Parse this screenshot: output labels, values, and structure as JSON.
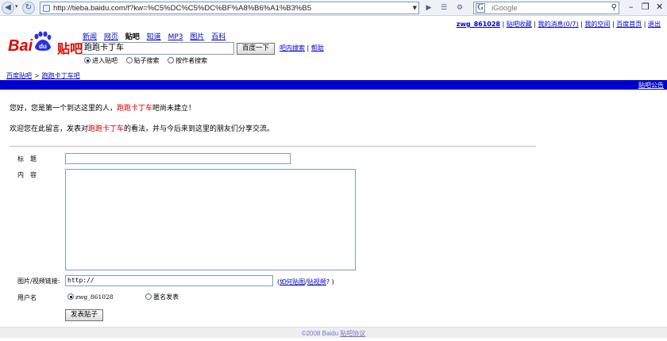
{
  "browser": {
    "address": "http://tieba.baidu.com/f?kw=%C5%DC%C5%DC%BF%A8%B6%A1%B3%B5",
    "search_placeholder": "iGoogle",
    "back_icon": "back-arrow-icon",
    "forward_icon": "forward-arrow-icon"
  },
  "userbar": {
    "username": "zwg_861028",
    "links": [
      "贴吧收藏",
      "我的消息(0/7)",
      "我的空间",
      "百度首页",
      "退出"
    ]
  },
  "logo": {
    "latin": "Bai",
    "paw_text": "du",
    "chinese": "贴吧"
  },
  "prodnav": {
    "items": [
      "新闻",
      "网页",
      "贴吧",
      "知道",
      "MP3",
      "图片",
      "百科"
    ],
    "current": "贴吧"
  },
  "search": {
    "keyword": "跑跑卡丁车",
    "button": "百度一下",
    "tool_links": [
      "吧内搜索",
      "帮助"
    ],
    "radios": [
      {
        "label": "进入贴吧",
        "checked": true
      },
      {
        "label": "贴子搜索",
        "checked": false
      },
      {
        "label": "按作者搜索",
        "checked": false
      }
    ]
  },
  "breadcrumb": {
    "root": "百度贴吧",
    "sep": ">",
    "current": "跑跑卡丁车吧"
  },
  "bluebar": {
    "notice": "贴吧公告"
  },
  "messages": {
    "line1_pre": "您好，您是第一个到达这里的人，",
    "line1_kw": "跑跑卡丁车",
    "line1_post": "吧尚未建立！",
    "line2_pre": "欢迎您在此留言，发表对",
    "line2_kw": "跑跑卡丁车",
    "line2_post": "的看法，并与今后来到这里的朋友们分享交流。"
  },
  "form": {
    "title_label": "标　题",
    "content_label": "内　容",
    "url_label": "图片/视频链接:",
    "url_value": "http://",
    "help_open": "(",
    "help_image": "如何贴图",
    "help_sep": "/",
    "help_video": "贴视频",
    "help_close": "? )",
    "username_label": "用户名",
    "user_options": [
      {
        "label": "zwg_861028",
        "checked": true
      },
      {
        "label": "匿名发表",
        "checked": false
      }
    ],
    "submit": "发表贴子"
  },
  "footer": {
    "copyright": "©2008 Baidu",
    "link": "贴吧协议"
  },
  "colors": {
    "brand_red": "#e10601",
    "bar_blue": "#0000cc",
    "link_blue": "#0000cc"
  }
}
